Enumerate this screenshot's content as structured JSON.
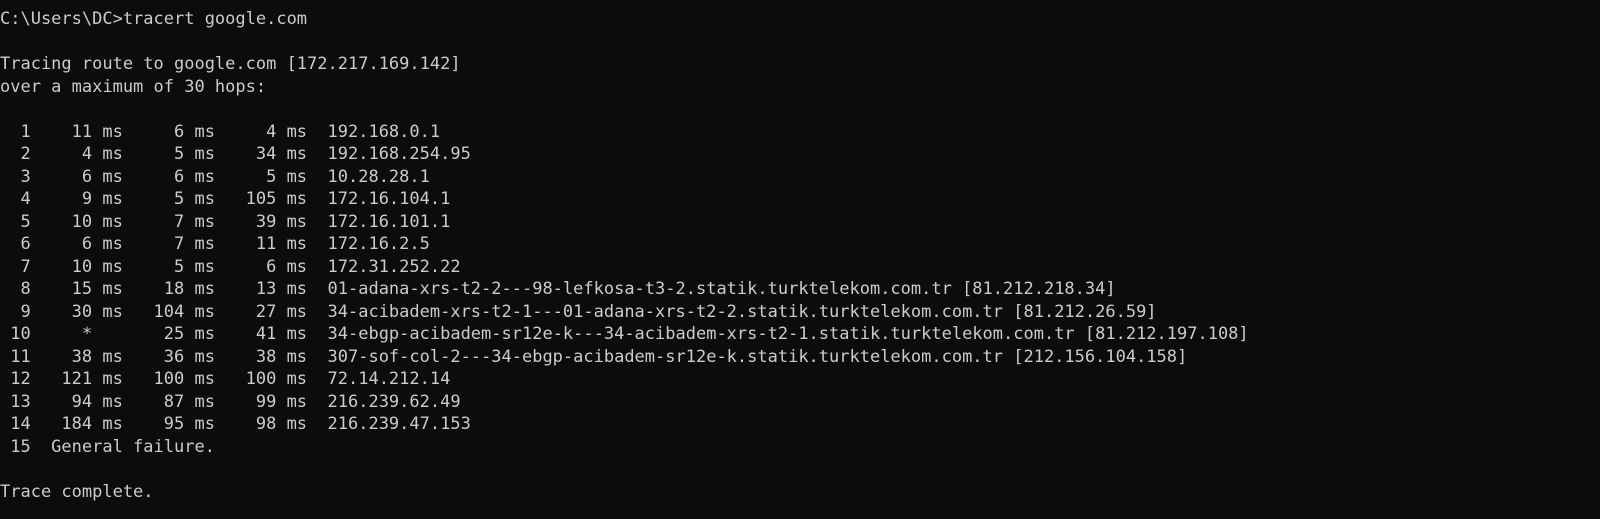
{
  "terminal": {
    "lines": [
      "C:\\Users\\DC>tracert google.com",
      "",
      "Tracing route to google.com [172.217.169.142]",
      "over a maximum of 30 hops:",
      "",
      "  1    11 ms     6 ms     4 ms  192.168.0.1",
      "  2     4 ms     5 ms    34 ms  192.168.254.95",
      "  3     6 ms     6 ms     5 ms  10.28.28.1",
      "  4     9 ms     5 ms   105 ms  172.16.104.1",
      "  5    10 ms     7 ms    39 ms  172.16.101.1",
      "  6     6 ms     7 ms    11 ms  172.16.2.5",
      "  7    10 ms     5 ms     6 ms  172.31.252.22",
      "  8    15 ms    18 ms    13 ms  01-adana-xrs-t2-2---98-lefkosa-t3-2.statik.turktelekom.com.tr [81.212.218.34]",
      "  9    30 ms   104 ms    27 ms  34-acibadem-xrs-t2-1---01-adana-xrs-t2-2.statik.turktelekom.com.tr [81.212.26.59]",
      " 10     *       25 ms    41 ms  34-ebgp-acibadem-sr12e-k---34-acibadem-xrs-t2-1.statik.turktelekom.com.tr [81.212.197.108]",
      " 11    38 ms    36 ms    38 ms  307-sof-col-2---34-ebgp-acibadem-sr12e-k.statik.turktelekom.com.tr [212.156.104.158]",
      " 12   121 ms   100 ms   100 ms  72.14.212.14",
      " 13    94 ms    87 ms    99 ms  216.239.62.49",
      " 14   184 ms    95 ms    98 ms  216.239.47.153",
      " 15  General failure.",
      "",
      "Trace complete."
    ]
  }
}
